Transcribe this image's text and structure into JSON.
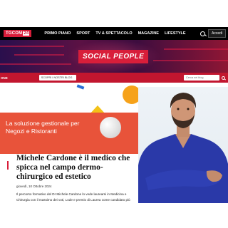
{
  "topbar": {
    "brand_text": "TGCOM",
    "brand_num": "24",
    "menu": [
      {
        "label": "PRIMO PIANO"
      },
      {
        "label": "SPORT"
      },
      {
        "label": "TV & SPETTACOLO"
      },
      {
        "label": "MAGAZINE"
      },
      {
        "label": "LIFESTYLE"
      }
    ],
    "login_label": "Accedi"
  },
  "banner": {
    "title": "SOCIAL PEOPLE"
  },
  "subnav": {
    "home_label": "ONE",
    "select_label": "SCOPRI I NOSTRI BLOG",
    "search_placeholder": "Cerca nel blog"
  },
  "ad": {
    "text": "La soluzione gestionale per Negozi e Ristoranti"
  },
  "article": {
    "title": "Michele Cardone è il medico che spicca nel campo dermo-chirurgico ed estetico",
    "date": "giovedì, 10 Ottobre 2024",
    "body": "Il percorso formativo del Dr Michele Cardone lo vede laurearsi in Medicina e Chirurgia con il massimo dei voti, Lode e premio di Laurea come candidato più"
  },
  "colors": {
    "brand_red": "#d81e3a",
    "ad_orange": "#e8533a",
    "scrub_blue": "#2a39a8"
  },
  "icons": {
    "top_search": "search-icon",
    "subnav_search": "search-icon"
  }
}
